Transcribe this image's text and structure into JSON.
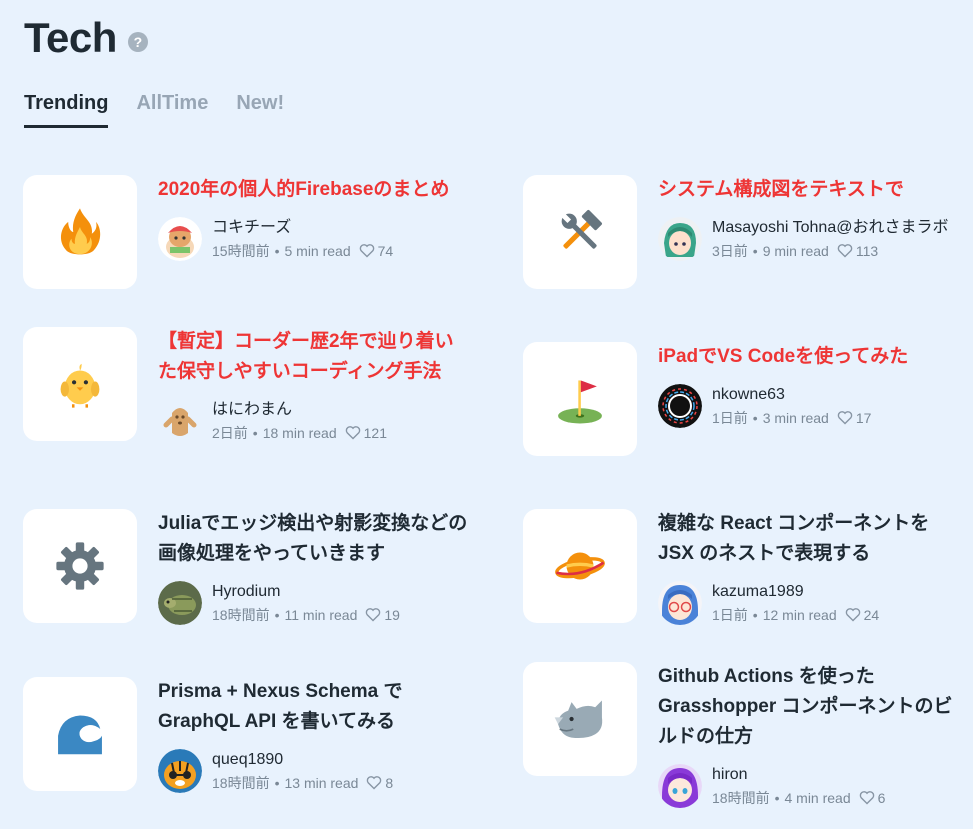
{
  "page": {
    "title": "Tech",
    "help_icon": "?"
  },
  "tabs": [
    {
      "label": "Trending",
      "active": true
    },
    {
      "label": "AllTime",
      "active": false
    },
    {
      "label": "New!",
      "active": false
    }
  ],
  "articles": [
    {
      "title": "2020年の個人的Firebaseのまとめ",
      "emoji": "fire-icon",
      "author": "コキチーズ",
      "time": "15時間前",
      "read": "5 min read",
      "likes": "74"
    },
    {
      "title": "システム構成図をテキストで",
      "emoji": "hammer-wrench-icon",
      "author": "Masayoshi Tohna@おれさまラボ",
      "time": "3日前",
      "read": "9 min read",
      "likes": "113"
    },
    {
      "title": "【暫定】コーダー歴2年で辿り着いた保守しやすいコーディング手法",
      "emoji": "chick-icon",
      "author": "はにわまん",
      "time": "2日前",
      "read": "18 min read",
      "likes": "121"
    },
    {
      "title": "iPadでVS Codeを使ってみた",
      "emoji": "golf-flag-icon",
      "author": "nkowne63",
      "time": "1日前",
      "read": "3 min read",
      "likes": "17"
    },
    {
      "title": "Juliaでエッジ検出や射影変換などの画像処理をやっていきます",
      "emoji": "gear-icon",
      "author": "Hyrodium",
      "time": "18時間前",
      "read": "11 min read",
      "likes": "19"
    },
    {
      "title": "複雑な React コンポーネントを JSX のネストで表現する",
      "emoji": "planet-icon",
      "author": "kazuma1989",
      "time": "1日前",
      "read": "12 min read",
      "likes": "24"
    },
    {
      "title": "Prisma + Nexus Schema で GraphQL API を書いてみる",
      "emoji": "wave-icon",
      "author": "queq1890",
      "time": "18時間前",
      "read": "13 min read",
      "likes": "8"
    },
    {
      "title": "Github Actions を使った Grasshopper コンポーネントのビルドの仕方",
      "emoji": "rhino-icon",
      "author": "hiron",
      "time": "18時間前",
      "read": "4 min read",
      "likes": "6"
    }
  ],
  "colors": {
    "background": "#e8f2fd",
    "visited_title": "#ee3535",
    "title": "#1f2a33",
    "muted": "#7a8896"
  }
}
